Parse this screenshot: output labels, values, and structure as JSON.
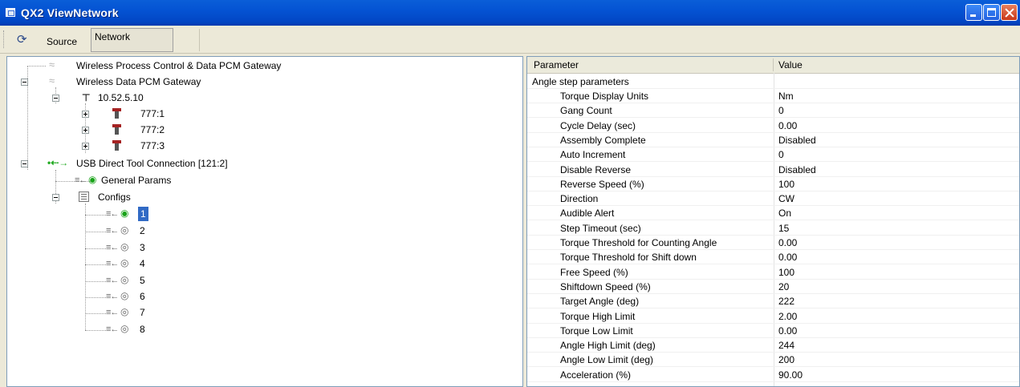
{
  "window": {
    "title": "QX2 ViewNetwork"
  },
  "toolbar": {
    "source_label": "Source",
    "network_value": "Network"
  },
  "tree": {
    "gateway1": "Wireless Process Control & Data PCM Gateway",
    "gateway2": "Wireless Data PCM Gateway",
    "ip": "10.52.5.10",
    "tool1": "777:1",
    "tool2": "777:2",
    "tool3": "777:3",
    "usb": "USB Direct Tool Connection [121:2]",
    "general_params": "General Params",
    "configs": "Configs",
    "config_items": [
      "1",
      "2",
      "3",
      "4",
      "5",
      "6",
      "7",
      "8"
    ]
  },
  "grid": {
    "col_parameter": "Parameter",
    "col_value": "Value",
    "group": "Angle step parameters",
    "rows": [
      {
        "name": "Torque Display Units",
        "value": "Nm"
      },
      {
        "name": "Gang Count",
        "value": "0"
      },
      {
        "name": "Cycle Delay (sec)",
        "value": "0.00"
      },
      {
        "name": "Assembly Complete",
        "value": "Disabled"
      },
      {
        "name": "Auto Increment",
        "value": "0"
      },
      {
        "name": "Disable Reverse",
        "value": "Disabled"
      },
      {
        "name": "Reverse Speed (%)",
        "value": "100"
      },
      {
        "name": "Direction",
        "value": "CW"
      },
      {
        "name": "Audible Alert",
        "value": "On"
      },
      {
        "name": "Step Timeout (sec)",
        "value": "15"
      },
      {
        "name": "Torque Threshold for Counting Angle",
        "value": "0.00"
      },
      {
        "name": "Torque Threshold for Shift down",
        "value": "0.00"
      },
      {
        "name": "Free Speed (%)",
        "value": "100"
      },
      {
        "name": "Shiftdown Speed (%)",
        "value": "20"
      },
      {
        "name": "Target Angle (deg)",
        "value": "222"
      },
      {
        "name": "Torque High Limit",
        "value": "2.00"
      },
      {
        "name": "Torque Low Limit",
        "value": "0.00"
      },
      {
        "name": "Angle High Limit (deg)",
        "value": "244"
      },
      {
        "name": "Angle Low Limit (deg)",
        "value": "200"
      },
      {
        "name": "Acceleration (%)",
        "value": "90.00"
      }
    ]
  }
}
